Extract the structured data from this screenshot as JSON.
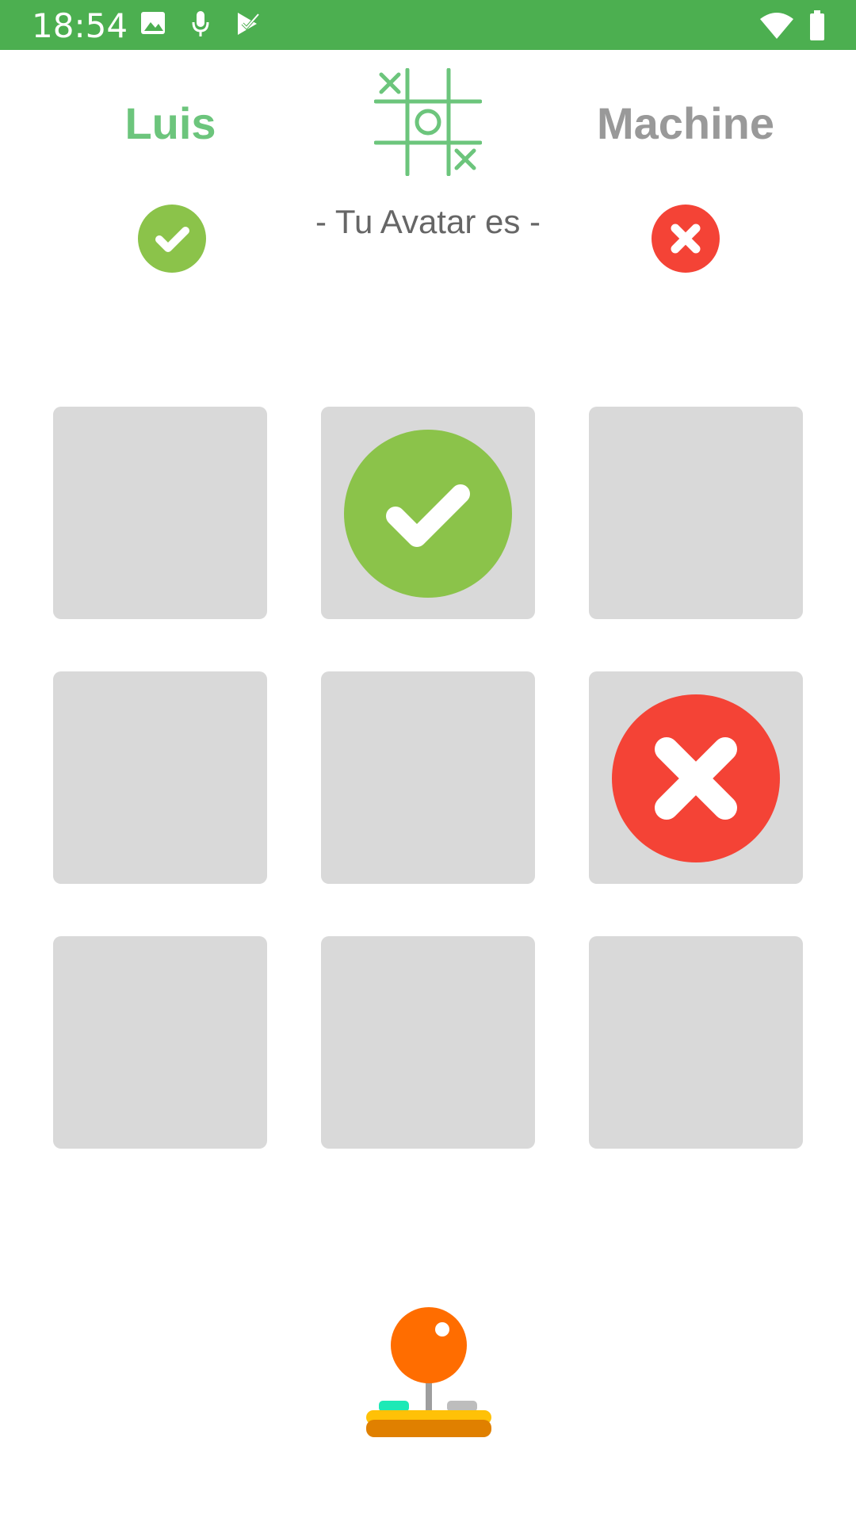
{
  "status_bar": {
    "time": "18:54",
    "background_color": "#4CAF50",
    "icons": [
      "image-icon",
      "microphone-icon",
      "task-check-icon",
      "wifi-icon",
      "battery-icon"
    ]
  },
  "header": {
    "player_one": {
      "name": "Luis",
      "color": "#6cc57c",
      "badge": "check-icon"
    },
    "player_two": {
      "name": "Machine",
      "color": "#999999",
      "badge": "cross-icon"
    },
    "logo_icon": "tic-tac-toe-logo-icon",
    "avatar_caption": "- Tu Avatar es -"
  },
  "board": {
    "cells": [
      {
        "mark": ""
      },
      {
        "mark": "check"
      },
      {
        "mark": ""
      },
      {
        "mark": ""
      },
      {
        "mark": ""
      },
      {
        "mark": "cross"
      },
      {
        "mark": ""
      },
      {
        "mark": ""
      },
      {
        "mark": ""
      }
    ],
    "colors": {
      "check": "#8BC34A",
      "cross": "#F44336",
      "empty": "#d9d9d9"
    }
  },
  "footer": {
    "icon": "joystick-icon"
  }
}
